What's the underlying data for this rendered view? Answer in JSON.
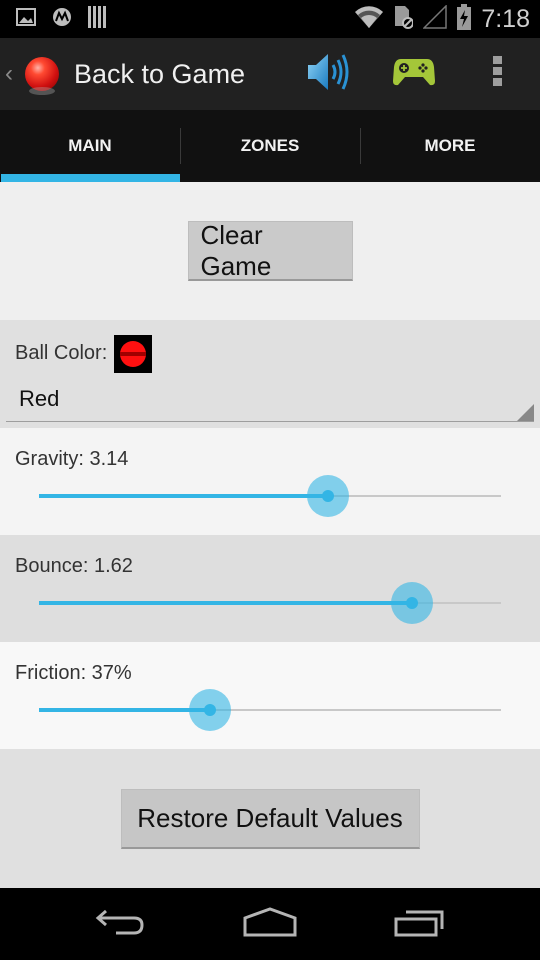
{
  "status_bar": {
    "time": "7:18",
    "left_icons": [
      "image-notification-icon",
      "motorola-icon",
      "barcode-icon"
    ],
    "right_icons": [
      "wifi-icon",
      "sim-blocked-icon",
      "cell-signal-icon",
      "battery-charging-icon"
    ]
  },
  "action_bar": {
    "title": "Back to Game",
    "app_icon": "red-ball-icon",
    "actions": [
      {
        "name": "sound",
        "icon": "speaker-icon"
      },
      {
        "name": "games",
        "icon": "gamepad-icon"
      },
      {
        "name": "overflow",
        "icon": "overflow-menu-icon"
      }
    ]
  },
  "tabs": [
    {
      "label": "MAIN",
      "active": true
    },
    {
      "label": "ZONES",
      "active": false
    },
    {
      "label": "MORE",
      "active": false
    }
  ],
  "main": {
    "clear_button": "Clear Game",
    "ball_color": {
      "label": "Ball Color:",
      "selected": "Red",
      "swatch_color": "#ff1010"
    },
    "sliders": [
      {
        "id": "gravity",
        "label": "Gravity: 3.14",
        "fraction": 0.626
      },
      {
        "id": "bounce",
        "label": "Bounce: 1.62",
        "fraction": 0.807
      },
      {
        "id": "friction",
        "label": "Friction: 37%",
        "fraction": 0.37
      }
    ],
    "restore_button": "Restore Default Values"
  },
  "colors": {
    "accent": "#33b5e5",
    "gamepad": "#a4c639"
  },
  "nav_bar": {
    "buttons": [
      "back-icon",
      "home-icon",
      "recent-apps-icon"
    ]
  }
}
